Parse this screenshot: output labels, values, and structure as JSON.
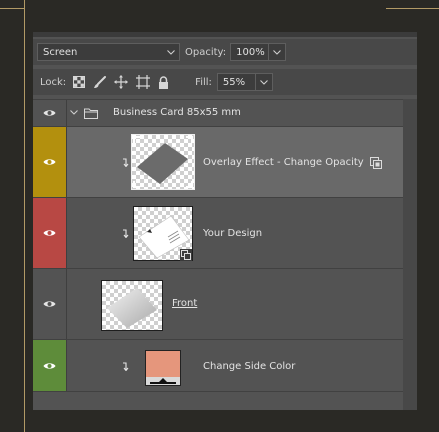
{
  "blend_mode": {
    "value": "Screen"
  },
  "opacity": {
    "label": "Opacity:",
    "value": "100%"
  },
  "lock": {
    "label": "Lock:"
  },
  "fill": {
    "label": "Fill:",
    "value": "55%"
  },
  "group": {
    "name": "Business Card 85x55 mm"
  },
  "layers": [
    {
      "name": "Overlay Effect - Change Opacity",
      "eye_color": "#b3900e",
      "icon": "smart-object-badge-icon"
    },
    {
      "name": "Your Design",
      "eye_color": "#b84844",
      "icon": "smart-object-badge-icon"
    },
    {
      "name": "Front",
      "eye_color": "#535353"
    },
    {
      "name": "Change Side Color",
      "eye_color": "#5e8c3a",
      "swatch_color": "#e5967c"
    }
  ],
  "colors": {
    "accent_gold": "#b29a66",
    "panel": "#535353",
    "selected_row": "#696969"
  }
}
